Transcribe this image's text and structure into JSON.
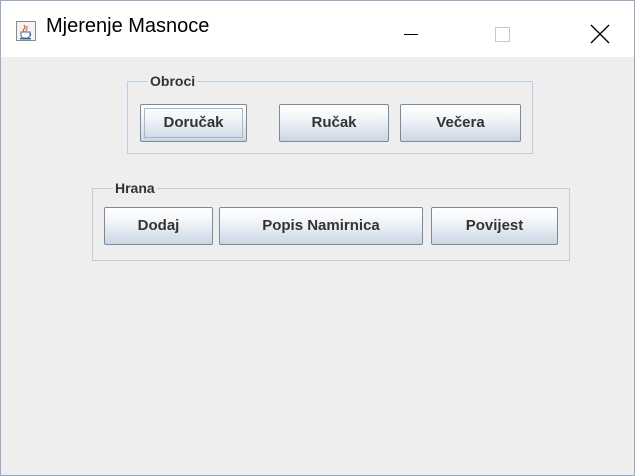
{
  "window": {
    "title": "Mjerenje Masnoce",
    "app_icon": "java-cup-icon",
    "controls": {
      "minimize_icon": "minimize-icon",
      "maximize_icon": "maximize-icon",
      "close_icon": "close-icon"
    }
  },
  "obroci": {
    "legend": "Obroci",
    "buttons": [
      {
        "label": "Doručak",
        "focused": true
      },
      {
        "label": "Ručak",
        "focused": false
      },
      {
        "label": "Večera",
        "focused": false
      }
    ]
  },
  "hrana": {
    "legend": "Hrana",
    "buttons": [
      {
        "label": "Dodaj"
      },
      {
        "label": "Popis Namirnica"
      },
      {
        "label": "Povijest"
      }
    ]
  },
  "colors": {
    "window_bg": "#eeeeee",
    "titlebar_bg": "#ffffff",
    "group_border": "#b8cfe5",
    "button_border": "#7a8a99",
    "button_text": "#333333"
  }
}
